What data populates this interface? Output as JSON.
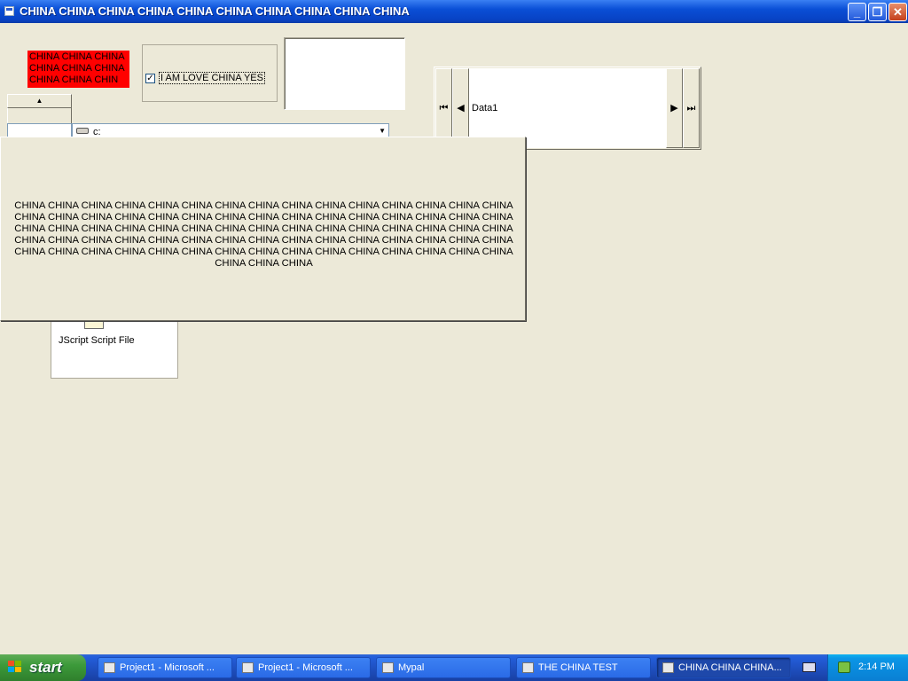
{
  "window": {
    "title": "CHINA CHINA CHINA CHINA CHINA CHINA CHINA CHINA CHINA CHINA",
    "minimize": "_",
    "maximize": "❐",
    "close": "✕"
  },
  "form": {
    "red_label": "CHINA CHINA CHINA CHINA CHINA CHINA CHINA CHINA CHIN",
    "checkbox": {
      "label": "I AM LOVE CHINA YES",
      "checked": true,
      "mark": "✓"
    },
    "data_control": {
      "caption": "Data1",
      "first": "⏮",
      "prev": "◀",
      "next": "▶",
      "last": "⏭"
    },
    "spin_up": "▲",
    "drive_list": {
      "value": "c:",
      "arrow": "▼"
    },
    "file_list": {
      "item": "JScript Script File"
    },
    "big_label": "CHINA CHINA CHINA CHINA CHINA CHINA CHINA CHINA CHINA CHINA CHINA CHINA CHINA CHINA CHINA CHINA CHINA CHINA CHINA CHINA CHINA CHINA CHINA CHINA CHINA CHINA CHINA CHINA CHINA CHINA CHINA CHINA CHINA CHINA CHINA CHINA CHINA CHINA CHINA CHINA CHINA CHINA CHINA CHINA CHINA CHINA CHINA CHINA CHINA CHINA CHINA CHINA CHINA CHINA CHINA CHINA CHINA CHINA CHINA CHINA CHINA CHINA CHINA CHINA CHINA CHINA CHINA CHINA CHINA CHINA CHINA CHINA CHINA CHINA CHINA CHINA CHINA CHINA"
  },
  "taskbar": {
    "start": "start",
    "tasks": [
      {
        "label": "Project1 - Microsoft ..."
      },
      {
        "label": "Project1 - Microsoft ..."
      },
      {
        "label": "Mypal"
      },
      {
        "label": "THE CHINA TEST"
      },
      {
        "label": "CHINA CHINA CHINA..."
      }
    ],
    "clock": "2:14 PM"
  },
  "colors": {
    "label_background": "#ff0000",
    "taskbar": "#245edb",
    "start": "#3c9a3a"
  }
}
